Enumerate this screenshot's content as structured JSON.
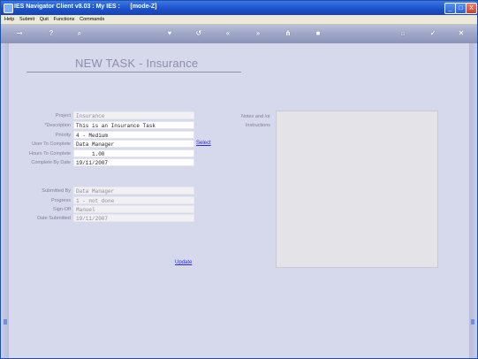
{
  "window": {
    "title": "IES Navigator Client v8.03 : My IES :      [mode-Z]",
    "controls": {
      "minimize": "_",
      "maximize": "□",
      "close": "X"
    }
  },
  "menu": {
    "items": [
      "Help",
      "Submit",
      "Quit",
      "Functions",
      "Commands"
    ]
  },
  "toolbar": {
    "icons": [
      {
        "name": "key-icon",
        "glyph": "⊸"
      },
      {
        "name": "help-icon",
        "glyph": "?"
      },
      {
        "name": "search-icon",
        "glyph": "⌕"
      },
      {
        "name": "favorite-icon",
        "glyph": "♥"
      },
      {
        "name": "refresh-icon",
        "glyph": "↺"
      },
      {
        "name": "back-icon",
        "glyph": "«"
      },
      {
        "name": "forward-icon",
        "glyph": "»"
      },
      {
        "name": "tree-icon",
        "glyph": "⋔"
      },
      {
        "name": "stop-icon",
        "glyph": "■"
      },
      {
        "name": "home-icon",
        "glyph": "⌂"
      },
      {
        "name": "accept-icon",
        "glyph": "✓"
      },
      {
        "name": "close-icon",
        "glyph": "✕"
      }
    ]
  },
  "form": {
    "title": "NEW TASK - Insurance",
    "fields": {
      "project": {
        "label": "Project",
        "value": "Insurance"
      },
      "description": {
        "label": "*Description",
        "value": "This is an Insurance Task"
      },
      "priority": {
        "label": "Priority",
        "value": "4 - Medium"
      },
      "user_to_complete": {
        "label": "User To Complete",
        "value": "Data Manager"
      },
      "hours_to_complete": {
        "label": "Hours To Complete",
        "value": "     1.00"
      },
      "complete_by_date": {
        "label": "Complete By Date",
        "value": "19/11/2007"
      },
      "submitted_by": {
        "label": "Submitted By",
        "value": "Data Manager"
      },
      "progress": {
        "label": "Progress",
        "value": "1 - not done"
      },
      "sign_off": {
        "label": "Sign-Off",
        "value": "Manuel"
      },
      "date_submitted": {
        "label": "Date Submitted",
        "value": "19/11/2007"
      }
    },
    "select_link": "Select",
    "update_link": "Update",
    "notes_label_1": "Notes and /or",
    "notes_label_2": "Instructions",
    "notes_value": ""
  }
}
